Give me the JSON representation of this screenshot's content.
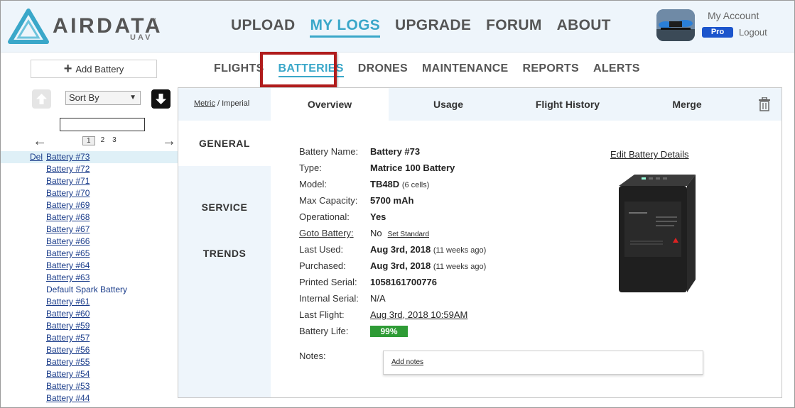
{
  "brand": {
    "name": "AIRDATA",
    "tm": "™",
    "sub": "UAV"
  },
  "topnav": [
    "UPLOAD",
    "MY LOGS",
    "UPGRADE",
    "FORUM",
    "ABOUT"
  ],
  "account": {
    "label": "My Account",
    "badge": "Pro",
    "logout": "Logout"
  },
  "sidebar": {
    "add_label": "Add Battery",
    "sort_label": "Sort By",
    "pages": [
      "1",
      "2",
      "3"
    ],
    "left_arrow": "←",
    "right_arrow": "→",
    "delete_label": "Del",
    "batteries": [
      "Battery #73",
      "Battery #72",
      "Battery #71",
      "Battery #70",
      "Battery #69",
      "Battery #68",
      "Battery #67",
      "Battery #66",
      "Battery #65",
      "Battery #64",
      "Battery #63",
      "Default Spark Battery",
      "Battery #61",
      "Battery #60",
      "Battery #59",
      "Battery #57",
      "Battery #56",
      "Battery #55",
      "Battery #54",
      "Battery #53",
      "Battery #44"
    ]
  },
  "subnav": [
    "FLIGHTS",
    "BATTERIES",
    "DRONES",
    "MAINTENANCE",
    "REPORTS",
    "ALERTS"
  ],
  "units": {
    "metric": "Metric",
    "sep": " / ",
    "imperial": "Imperial"
  },
  "tabs": [
    "Overview",
    "Usage",
    "Flight History",
    "Merge"
  ],
  "side_tabs": [
    "GENERAL",
    "SERVICE",
    "TRENDS"
  ],
  "details": {
    "battery_name": {
      "label": "Battery Name:",
      "value": "Battery #73"
    },
    "type": {
      "label": "Type:",
      "value": "Matrice 100 Battery"
    },
    "model": {
      "label": "Model:",
      "value": "TB48D",
      "extra": "(6 cells)"
    },
    "max_capacity": {
      "label": "Max Capacity:",
      "value": "5700 mAh"
    },
    "operational": {
      "label": "Operational:",
      "value": "Yes"
    },
    "goto_battery": {
      "label": "Goto Battery:",
      "value": "No",
      "action": "Set Standard"
    },
    "last_used": {
      "label": "Last Used:",
      "value": "Aug 3rd, 2018",
      "extra": "(11 weeks ago)"
    },
    "purchased": {
      "label": "Purchased:",
      "value": "Aug 3rd, 2018",
      "extra": "(11 weeks ago)"
    },
    "printed_serial": {
      "label": "Printed Serial:",
      "value": "1058161700776"
    },
    "internal_serial": {
      "label": "Internal Serial:",
      "value": "N/A"
    },
    "last_flight": {
      "label": "Last Flight:",
      "value": "Aug 3rd, 2018 10:59AM"
    },
    "battery_life": {
      "label": "Battery Life:",
      "value": "99%",
      "percent": 99
    }
  },
  "edit_label": "Edit Battery Details",
  "notes": {
    "label": "Notes:",
    "add": "Add notes"
  },
  "colors": {
    "accent": "#3aa7c9",
    "highlight": "#b01c1c",
    "life_good": "#2e9b35",
    "pro": "#1c55cc"
  }
}
